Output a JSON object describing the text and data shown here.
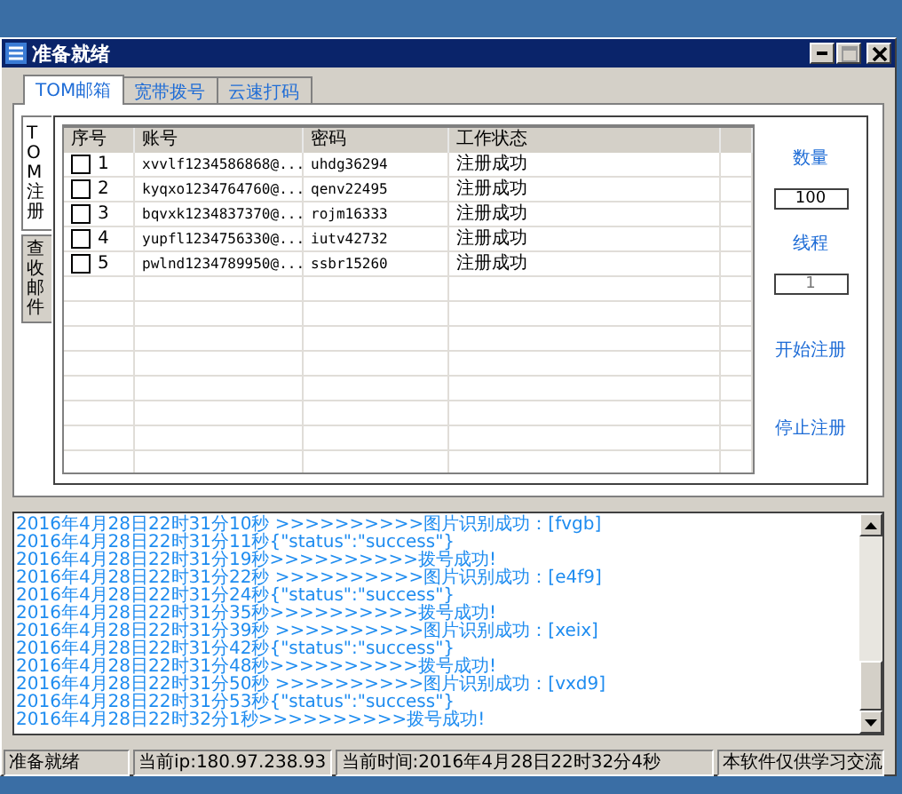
{
  "window": {
    "title": "准备就绪"
  },
  "tabs": [
    {
      "label": "TOM邮箱",
      "selected": true
    },
    {
      "label": "宽带拨号",
      "selected": false
    },
    {
      "label": "云速打码",
      "selected": false
    }
  ],
  "side_tabs": [
    {
      "label": "TOM注册",
      "selected": true
    },
    {
      "label": "查收邮件",
      "selected": false
    }
  ],
  "table": {
    "columns": [
      "序号",
      "账号",
      "密码",
      "工作状态"
    ],
    "rows": [
      {
        "checked": false,
        "number": "1",
        "account": "xvvlf1234586868@...",
        "password": "uhdg36294",
        "status": "注册成功"
      },
      {
        "checked": false,
        "number": "2",
        "account": "kyqxo1234764760@...",
        "password": "qenv22495",
        "status": "注册成功"
      },
      {
        "checked": false,
        "number": "3",
        "account": "bqvxk1234837370@...",
        "password": "rojm16333",
        "status": "注册成功"
      },
      {
        "checked": false,
        "number": "4",
        "account": "yupfl1234756330@...",
        "password": "iutv42732",
        "status": "注册成功"
      },
      {
        "checked": false,
        "number": "5",
        "account": "pwlnd1234789950@...",
        "password": "ssbr15260",
        "status": "注册成功"
      }
    ]
  },
  "controls": {
    "count_label": "数量",
    "count_value": "100",
    "threads_label": "线程",
    "threads_value": "1",
    "start_button": "开始注册",
    "stop_button": "停止注册"
  },
  "log": [
    "2016年4月28日22时31分10秒 >>>>>>>>>>图片识别成功：[fvgb]",
    "2016年4月28日22时31分11秒{\"status\":\"success\"}",
    "2016年4月28日22时31分19秒>>>>>>>>>>拨号成功!",
    "2016年4月28日22时31分22秒 >>>>>>>>>>图片识别成功：[e4f9]",
    "2016年4月28日22时31分24秒{\"status\":\"success\"}",
    "2016年4月28日22时31分35秒>>>>>>>>>>拨号成功!",
    "2016年4月28日22时31分39秒 >>>>>>>>>>图片识别成功：[xeix]",
    "2016年4月28日22时31分42秒{\"status\":\"success\"}",
    "2016年4月28日22时31分48秒>>>>>>>>>>拨号成功!",
    "2016年4月28日22时31分50秒 >>>>>>>>>>图片识别成功：[vxd9]",
    "2016年4月28日22时31分53秒{\"status\":\"success\"}",
    "2016年4月28日22时32分1秒>>>>>>>>>>拨号成功!"
  ],
  "status_bar": [
    "准备就绪",
    "当前ip:180.97.238.93",
    "当前时间:2016年4月28日22时32分4秒",
    "本软件仅供学习交流"
  ]
}
